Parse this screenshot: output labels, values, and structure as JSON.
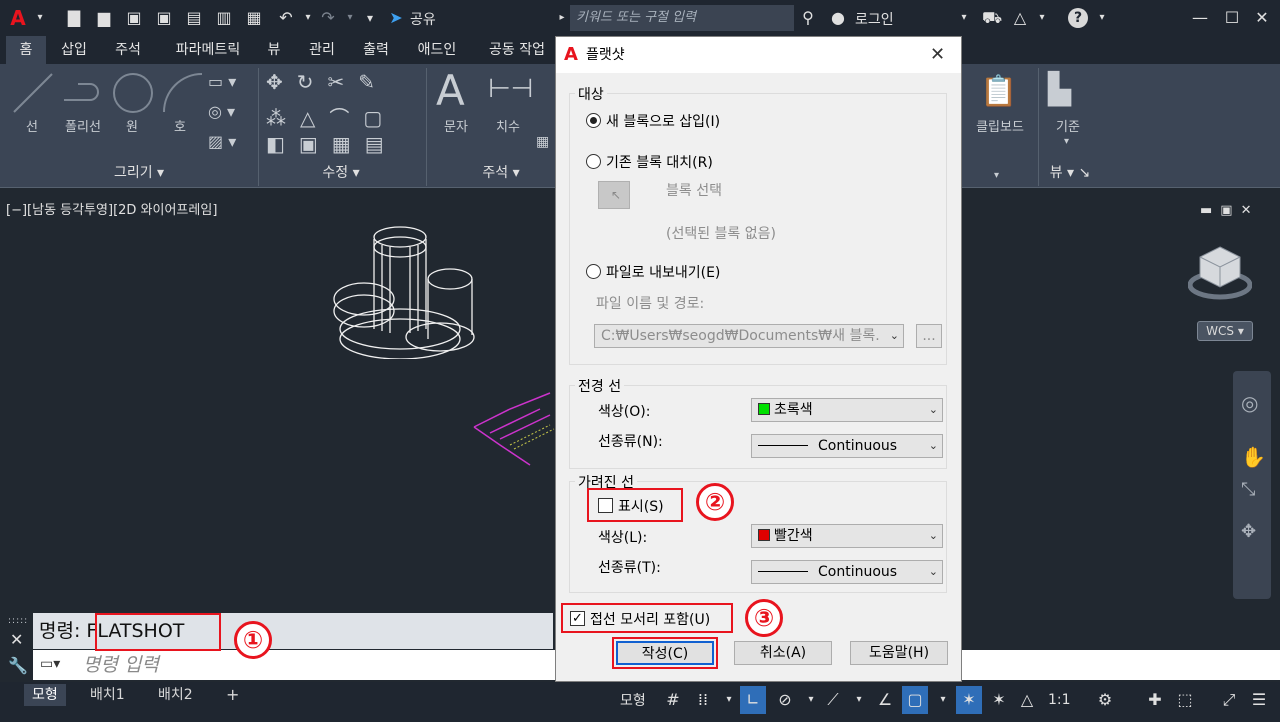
{
  "search": {
    "placeholder": "키워드 또는 구절 입력"
  },
  "titlebar": {
    "share": "공유",
    "login": "로그인"
  },
  "tabs": [
    "홈",
    "삽입",
    "주석",
    "파라메트릭",
    "뷰",
    "관리",
    "출력",
    "애드인",
    "공동 작업"
  ],
  "ribbon": {
    "draw": {
      "line": "선",
      "polyline": "폴리선",
      "circle": "원",
      "arc": "호",
      "title": "그리기"
    },
    "modify": {
      "title": "수정"
    },
    "annotate": {
      "text": "문자",
      "dim": "치수",
      "title": "주석"
    },
    "clipboard": "클립보드",
    "base": "기준",
    "view_title": "뷰"
  },
  "viewport": {
    "label": "[−][남동 등각투영][2D 와이어프레임]",
    "wcs": "WCS"
  },
  "command": {
    "history": "명령:  FLATSHOT",
    "placeholder": "명령 입력"
  },
  "layouts": [
    "모형",
    "배치1",
    "배치2"
  ],
  "status": {
    "model": "모형",
    "scale": "1:1"
  },
  "dialog": {
    "title": "플랫샷",
    "dest": {
      "group": "대상",
      "insert": "새 블록으로 삽입(I)",
      "replace": "기존 블록 대치(R)",
      "select_block": "블록 선택",
      "no_selection": "(선택된 블록 없음)",
      "export": "파일로 내보내기(E)",
      "path_label": "파일 이름 및 경로:",
      "path_value": "C:₩Users₩seogd₩Documents₩새 블록.",
      "browse": "..."
    },
    "fg": {
      "group": "전경 선",
      "color_label": "색상(O):",
      "color_value": "초록색",
      "color_hex": "#00e000",
      "lt_label": "선종류(N):",
      "lt_value": "Continuous"
    },
    "hidden": {
      "group": "가려진 선",
      "show": "표시(S)",
      "color_label": "색상(L):",
      "color_value": "빨간색",
      "color_hex": "#e00000",
      "lt_label": "선종류(T):",
      "lt_value": "Continuous"
    },
    "tangent": "접선 모서리 포함(U)",
    "buttons": {
      "create": "작성(C)",
      "cancel": "취소(A)",
      "help": "도움말(H)"
    }
  },
  "callouts": [
    "①",
    "②",
    "③"
  ]
}
